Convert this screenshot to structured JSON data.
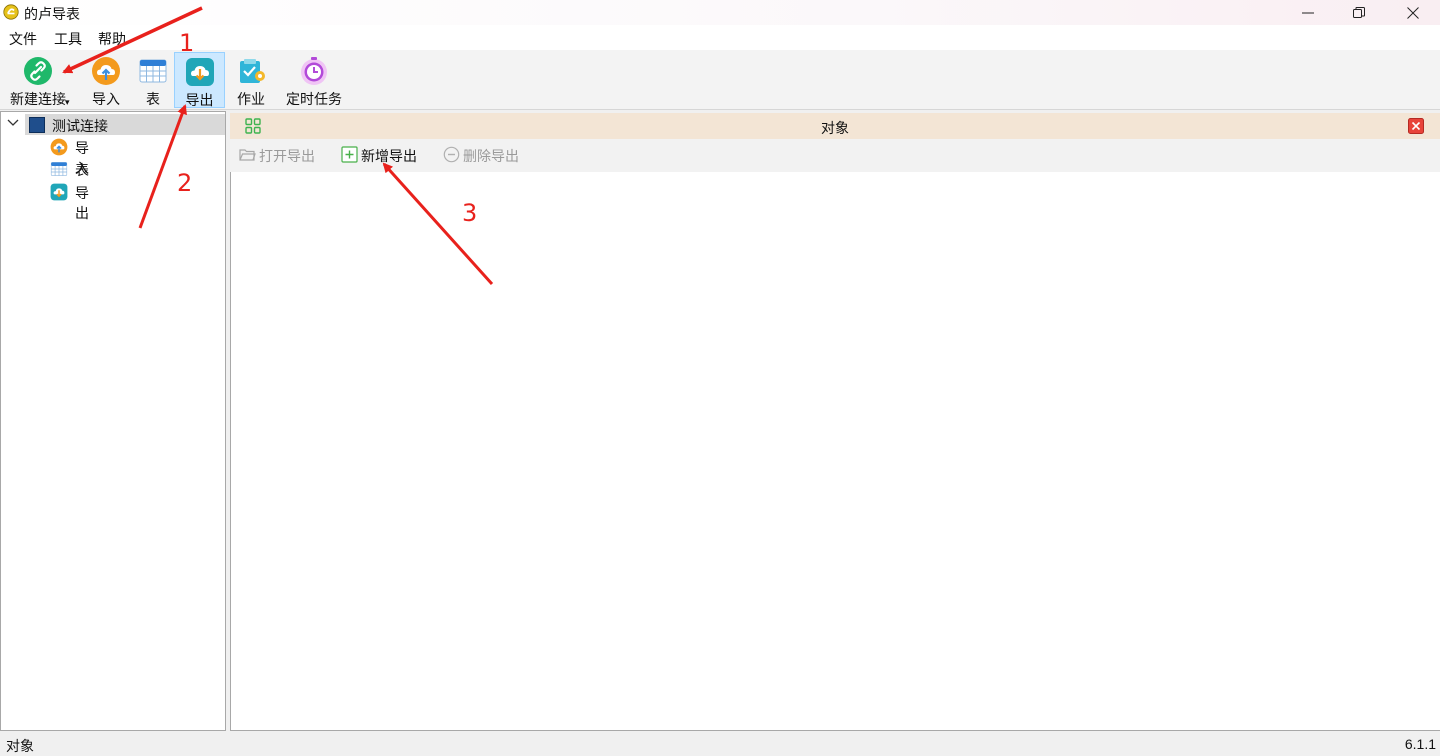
{
  "window": {
    "title": "的卢导表",
    "controls": {
      "minimize": "minimize-icon",
      "maximize": "restore-icon",
      "close": "close-icon"
    }
  },
  "menu": {
    "items": [
      {
        "label": "文件"
      },
      {
        "label": "工具"
      },
      {
        "label": "帮助"
      }
    ]
  },
  "toolbar": {
    "items": [
      {
        "label": "新建连接",
        "icon": "link-icon"
      },
      {
        "label": "导入",
        "icon": "import-cloud-icon"
      },
      {
        "label": "表",
        "icon": "table-icon"
      },
      {
        "label": "导出",
        "icon": "export-cloud-icon",
        "active": true
      },
      {
        "label": "作业",
        "icon": "job-icon"
      },
      {
        "label": "定时任务",
        "icon": "timer-icon"
      }
    ]
  },
  "tree": {
    "root": {
      "label": "测试连接",
      "expanded": true
    },
    "children": [
      {
        "label": "导入",
        "icon": "import-cloud-icon"
      },
      {
        "label": "表",
        "icon": "table-icon"
      },
      {
        "label": "导出",
        "icon": "export-cloud-icon"
      }
    ]
  },
  "object_panel": {
    "title": "对象",
    "actions": [
      {
        "label": "打开导出",
        "icon": "folder-open-icon",
        "enabled": false
      },
      {
        "label": "新增导出",
        "icon": "plus-box-icon",
        "enabled": true
      },
      {
        "label": "删除导出",
        "icon": "minus-circle-icon",
        "enabled": false
      }
    ]
  },
  "status": {
    "left": "对象",
    "version": "6.1.1"
  },
  "annotations": {
    "labels": [
      "1",
      "2",
      "3"
    ],
    "color": "#e8211c"
  },
  "colors": {
    "active_toolbar_bg": "#cce8ff",
    "panel_header_bg": "#f3e5d5",
    "annotation_red": "#e8211c"
  }
}
